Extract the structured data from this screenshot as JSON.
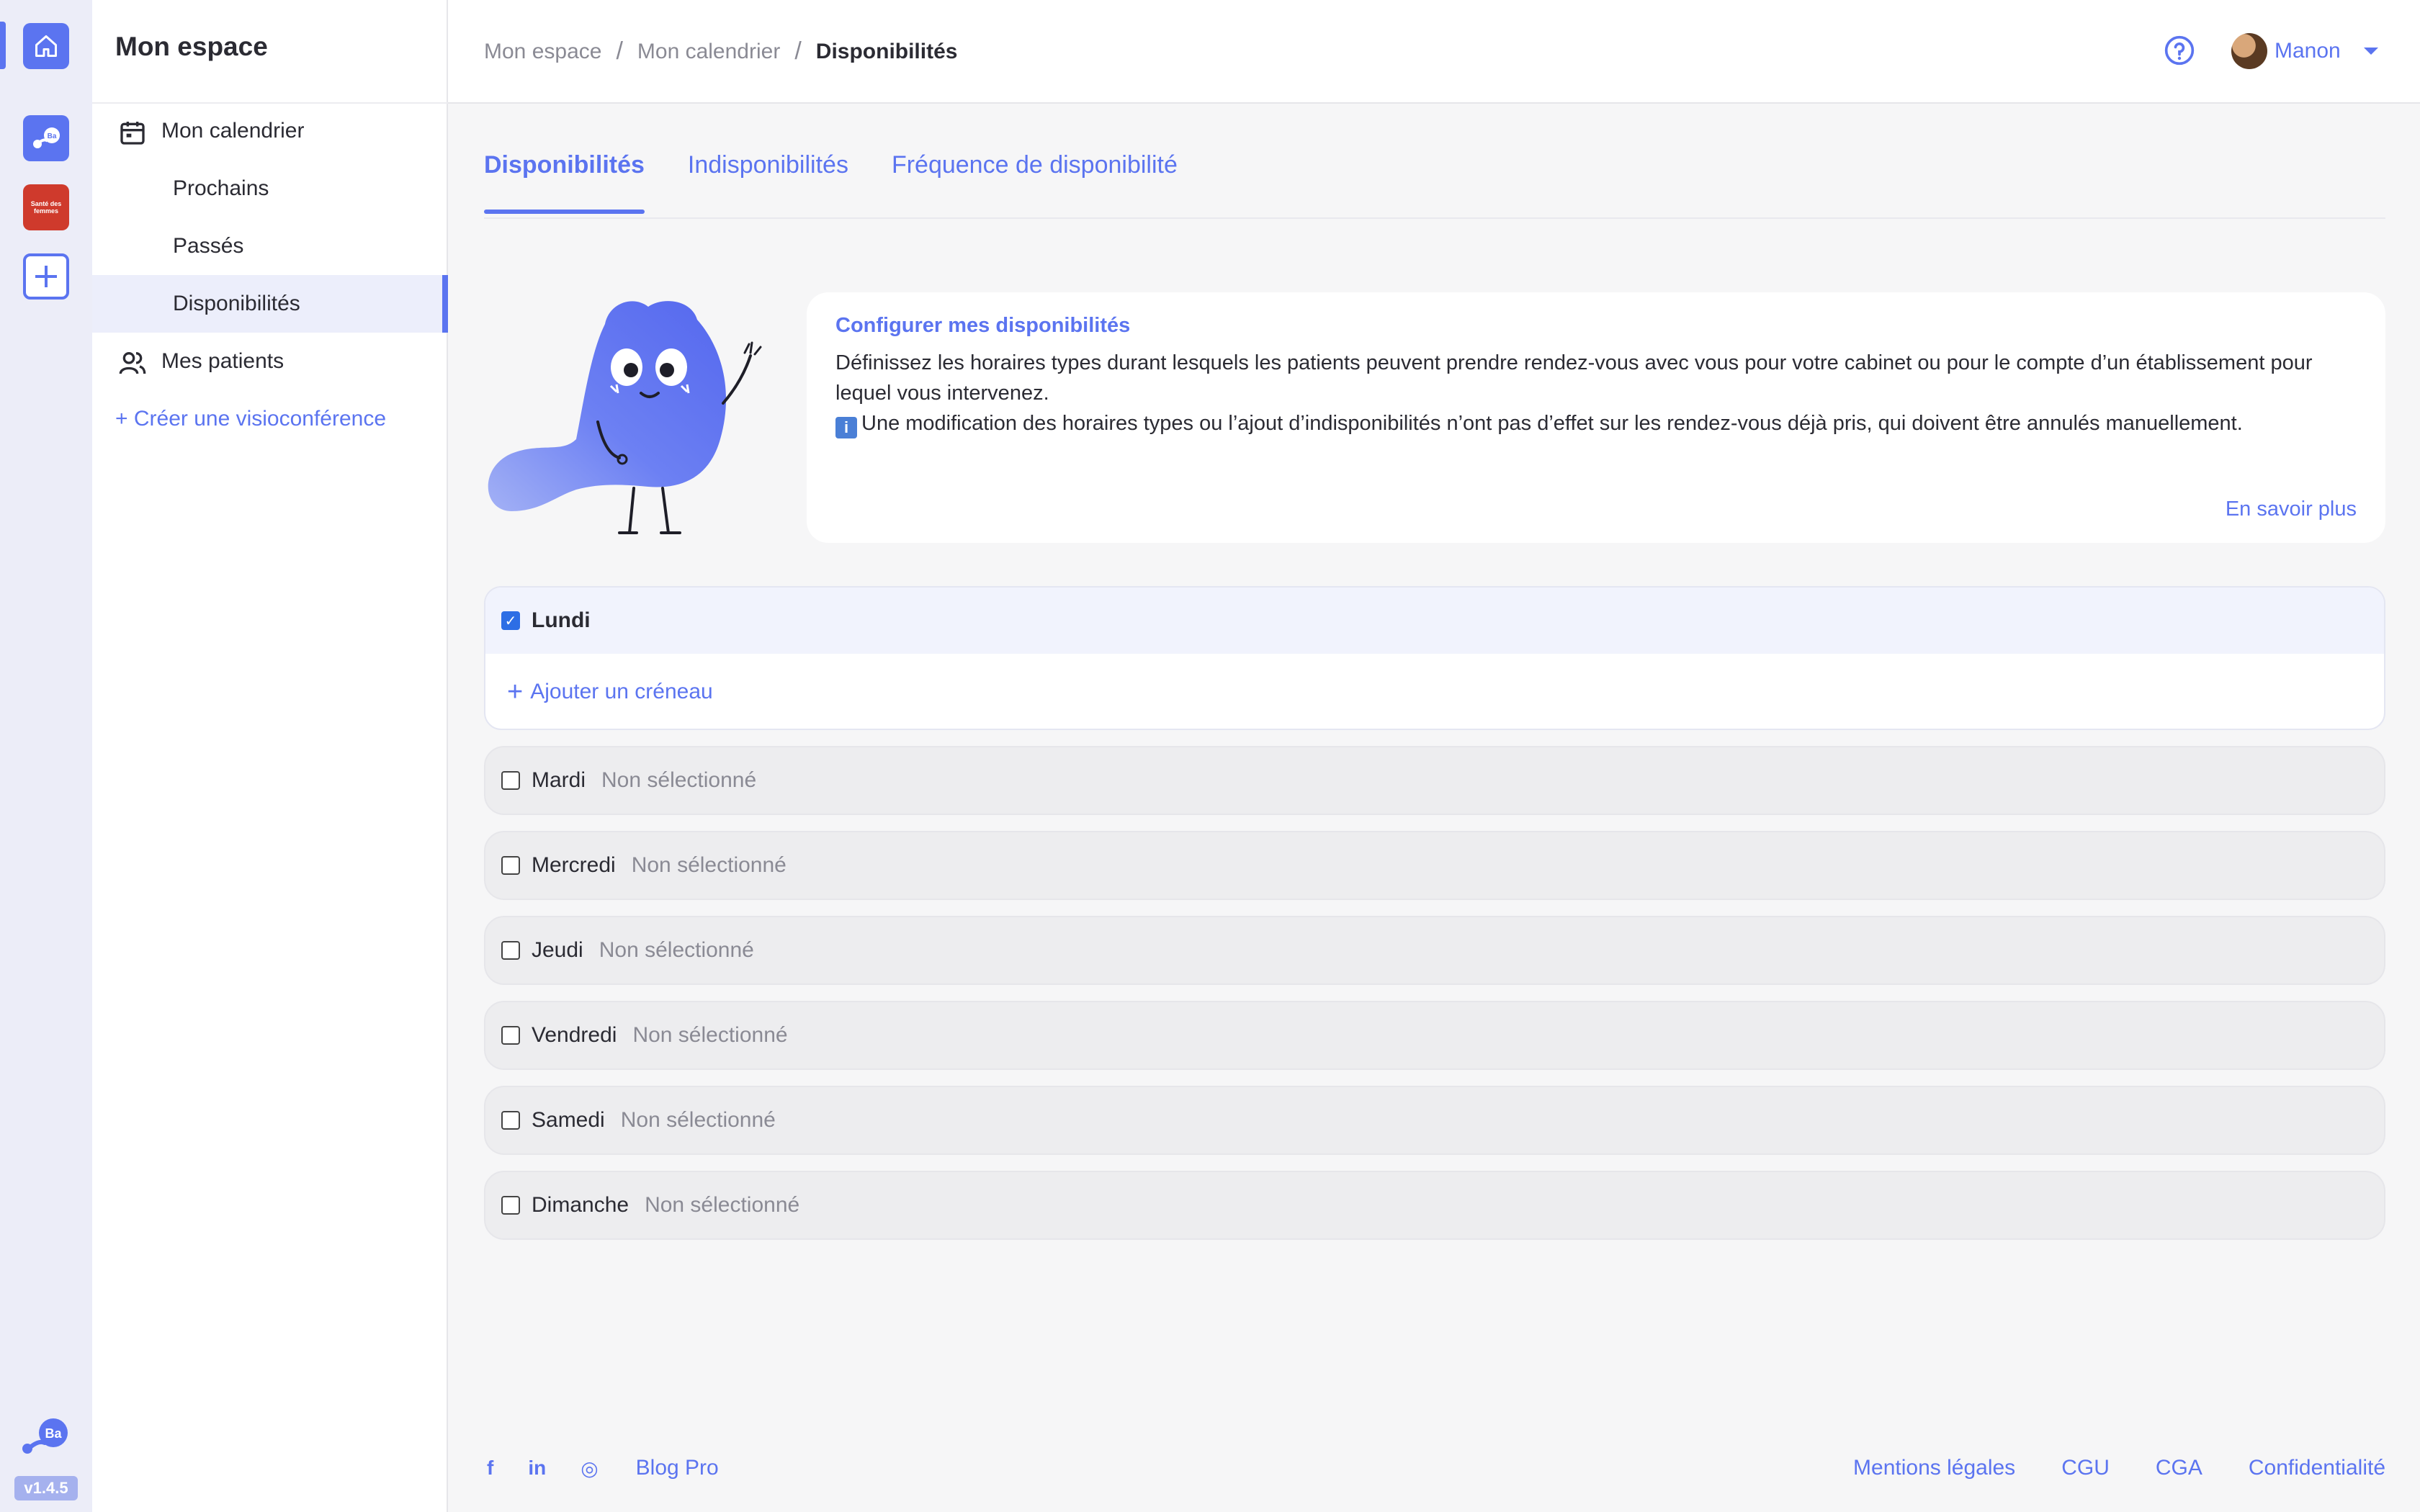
{
  "app": {
    "version": "v1.4.5",
    "accent": "#5b74f0",
    "rail_items": [
      "home-icon",
      "ba-app-icon",
      "sdf-app-icon",
      "add-app-icon"
    ],
    "sdf_logo_text": "Santé des femmes"
  },
  "sidebar": {
    "title": "Mon espace",
    "items": [
      {
        "label": "Mon calendrier",
        "icon": "calendar-icon"
      },
      {
        "label": "Prochains"
      },
      {
        "label": "Passés"
      },
      {
        "label": "Disponibilités",
        "active": true
      },
      {
        "label": "Mes patients",
        "icon": "users-icon"
      }
    ],
    "create_link": "+ Créer une visioconférence"
  },
  "header": {
    "breadcrumb": [
      "Mon espace",
      "Mon calendrier",
      "Disponibilités"
    ],
    "separator": "/",
    "user_name": "Manon"
  },
  "tabs": [
    {
      "label": "Disponibilités",
      "active": true
    },
    {
      "label": "Indisponibilités"
    },
    {
      "label": "Fréquence de disponibilité"
    }
  ],
  "info": {
    "title": "Configurer mes disponibilités",
    "line1": "Définissez les horaires types durant lesquels les patients peuvent prendre rendez-vous avec vous pour votre cabinet ou pour le compte d’un établissement pour lequel vous intervenez.",
    "line2": "Une modification des horaires types ou l’ajout d’indisponibilités n’ont pas d’effet sur les rendez-vous déjà pris, qui doivent être annulés manuellement.",
    "info_glyph": "i",
    "link": "En savoir plus"
  },
  "days": [
    {
      "name": "Lundi",
      "checked": true,
      "add_slot": "Ajouter un créneau"
    },
    {
      "name": "Mardi",
      "checked": false,
      "status": "Non sélectionné"
    },
    {
      "name": "Mercredi",
      "checked": false,
      "status": "Non sélectionné"
    },
    {
      "name": "Jeudi",
      "checked": false,
      "status": "Non sélectionné"
    },
    {
      "name": "Vendredi",
      "checked": false,
      "status": "Non sélectionné"
    },
    {
      "name": "Samedi",
      "checked": false,
      "status": "Non sélectionné"
    },
    {
      "name": "Dimanche",
      "checked": false,
      "status": "Non sélectionné"
    }
  ],
  "footer": {
    "social": [
      {
        "glyph": "f",
        "icon": "facebook-icon"
      },
      {
        "glyph": "in",
        "icon": "linkedin-icon"
      },
      {
        "glyph": "◎",
        "icon": "instagram-icon"
      }
    ],
    "blog": "Blog Pro",
    "links": [
      "Mentions légales",
      "CGU",
      "CGA",
      "Confidentialité"
    ]
  }
}
